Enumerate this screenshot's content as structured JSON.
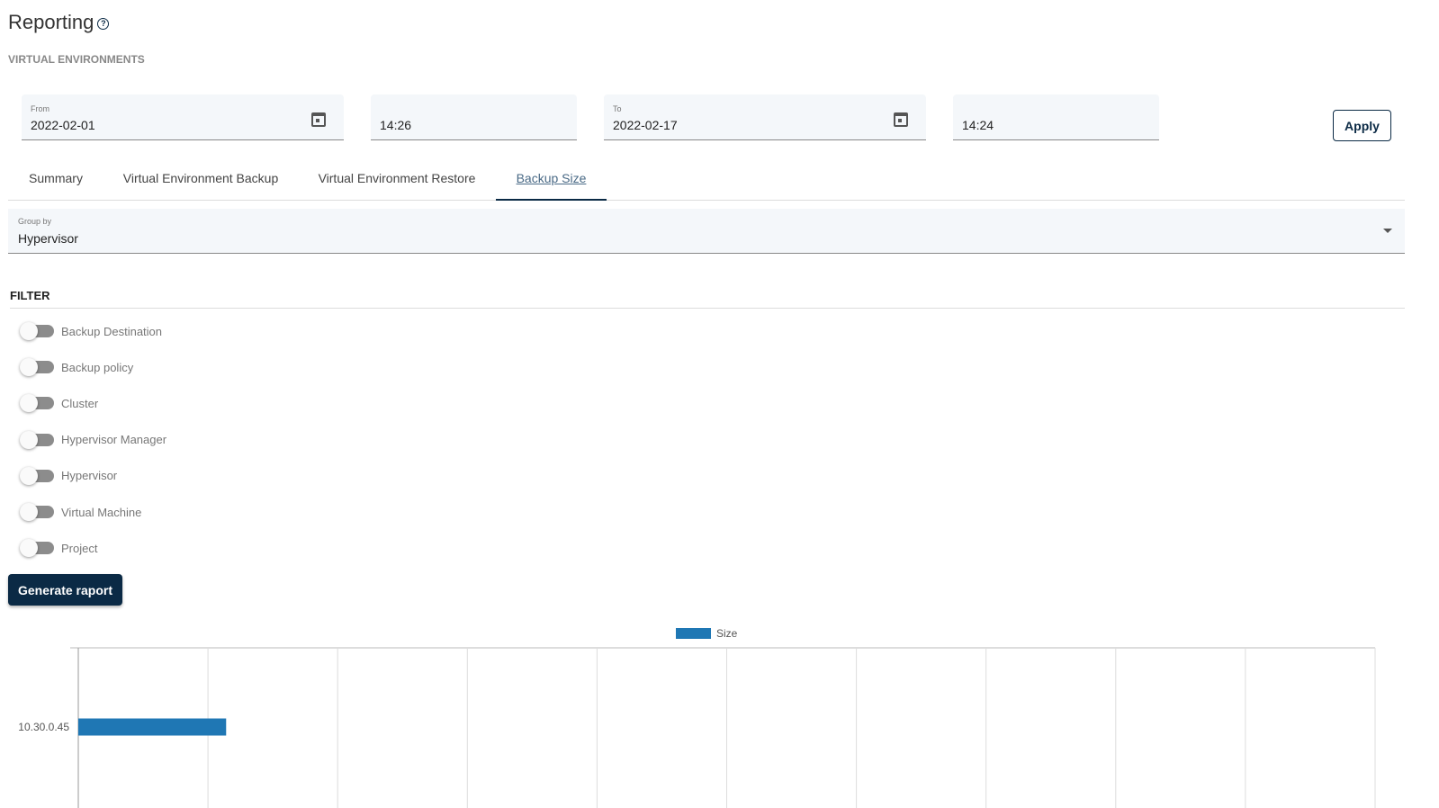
{
  "header": {
    "title": "Reporting",
    "subtitle": "VIRTUAL ENVIRONMENTS"
  },
  "range": {
    "from_label": "From",
    "from_date": "2022-02-01",
    "from_time": "14:26",
    "to_label": "To",
    "to_date": "2022-02-17",
    "to_time": "14:24",
    "apply": "Apply"
  },
  "tabs": [
    {
      "label": "Summary"
    },
    {
      "label": "Virtual Environment Backup"
    },
    {
      "label": "Virtual Environment Restore"
    },
    {
      "label": "Backup Size"
    }
  ],
  "group_by": {
    "label": "Group by",
    "value": "Hypervisor"
  },
  "filter": {
    "title": "FILTER",
    "toggles": [
      {
        "label": "Backup Destination",
        "on": false
      },
      {
        "label": "Backup policy",
        "on": false
      },
      {
        "label": "Cluster",
        "on": false
      },
      {
        "label": "Hypervisor Manager",
        "on": false
      },
      {
        "label": "Hypervisor",
        "on": false
      },
      {
        "label": "Virtual Machine",
        "on": false
      },
      {
        "label": "Project",
        "on": false
      }
    ]
  },
  "generate": "Generate raport",
  "chart_data": {
    "type": "bar",
    "orientation": "horizontal",
    "categories": [
      "10.30.0.45"
    ],
    "series": [
      {
        "name": "Size",
        "color": "#1f77b4",
        "values": [
          1.14
        ]
      }
    ],
    "xlim": [
      0,
      10
    ],
    "grid": true,
    "legend": "top-center",
    "note": "x-axis tick labels not visible; values in gridline units"
  }
}
